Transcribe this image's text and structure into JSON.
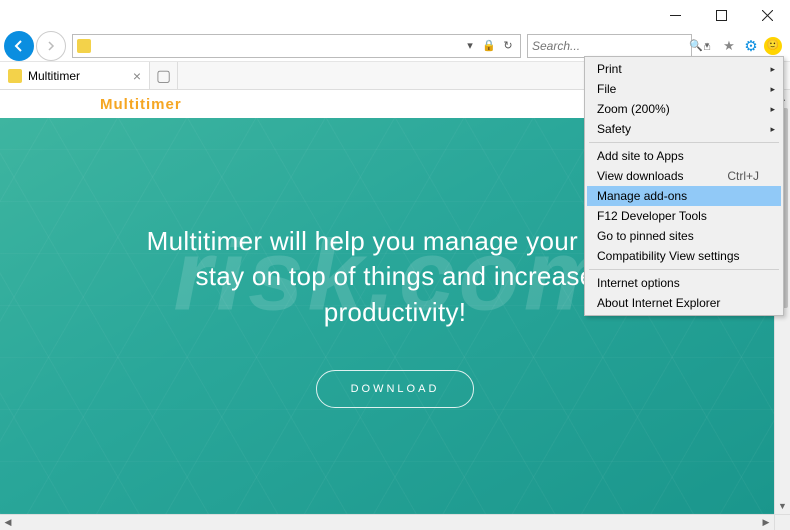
{
  "window": {
    "title": "Multitimer"
  },
  "toolbar": {
    "address_value": "",
    "search_placeholder": "Search..."
  },
  "tabs": [
    {
      "label": "Multitimer"
    }
  ],
  "page": {
    "logo": "Multitimer",
    "hero_headline": "Multitimer will help you manage your time, stay on top of things and increase productivity!",
    "download_label": "DOWNLOAD"
  },
  "menu": {
    "items": [
      {
        "label": "Print",
        "submenu": true
      },
      {
        "label": "File",
        "submenu": true
      },
      {
        "label": "Zoom (200%)",
        "submenu": true
      },
      {
        "label": "Safety",
        "submenu": true
      },
      {
        "sep": true
      },
      {
        "label": "Add site to Apps"
      },
      {
        "label": "View downloads",
        "shortcut": "Ctrl+J"
      },
      {
        "label": "Manage add-ons",
        "highlight": true
      },
      {
        "label": "F12 Developer Tools"
      },
      {
        "label": "Go to pinned sites"
      },
      {
        "label": "Compatibility View settings"
      },
      {
        "sep": true
      },
      {
        "label": "Internet options"
      },
      {
        "label": "About Internet Explorer"
      }
    ]
  },
  "watermark": "risk.com"
}
